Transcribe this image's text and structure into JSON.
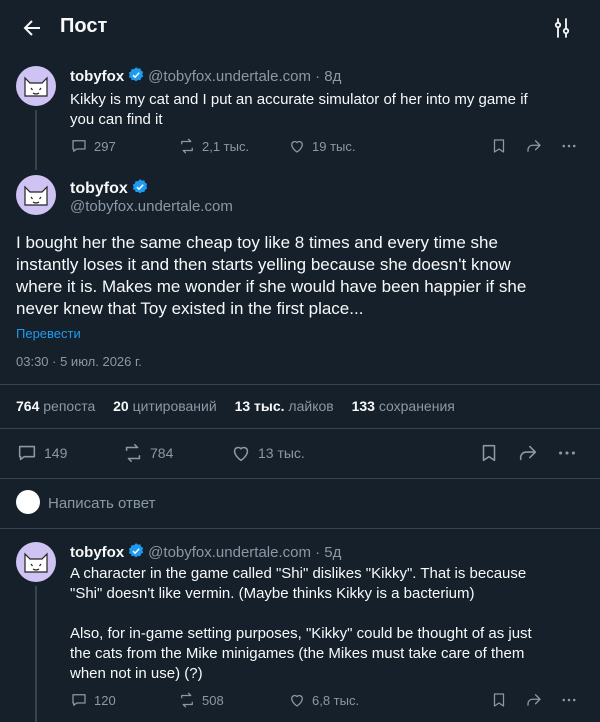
{
  "header": {
    "title": "Пост"
  },
  "parent": {
    "name": "tobyfox",
    "handle_time": "@tobyfox.undertale.com · 8д",
    "line1": "Kikky is my cat and I put an accurate simulator of her into my game if",
    "line2": "you can find it",
    "replies": "297",
    "reposts": "2,1 тыс.",
    "likes": "19 тыс."
  },
  "main": {
    "name": "tobyfox",
    "handle": "@tobyfox.undertale.com",
    "line1": "I bought her the same cheap toy like 8 times and every time she",
    "line2": "instantly loses it and then starts yelling because she doesn't know",
    "line3": "where it is. Makes me wonder if she would have been happier if she",
    "line4": "never knew that Toy existed in the first place...",
    "translate": "Перевести",
    "timestamp": "03:30 · 5 июл. 2026 г.",
    "stats": {
      "reposts_count": "764",
      "reposts_label": "репоста",
      "quotes_count": "20",
      "quotes_label": "цитирований",
      "likes_count": "13 тыс.",
      "likes_label": "лайков",
      "bookmarks_count": "133",
      "bookmarks_label": "сохранения"
    },
    "replies": "149",
    "reposts": "784",
    "likes": "13 тыс."
  },
  "compose": {
    "placeholder": "Написать ответ"
  },
  "reply": {
    "name": "tobyfox",
    "handle_time": "@tobyfox.undertale.com · 5д",
    "line1": "A character in the game called \"Shi\" dislikes \"Kikky\". That is because",
    "line2": "\"Shi\" doesn't like vermin. (Maybe thinks Kikky is a bacterium)",
    "line3": "Also, for in-game setting purposes, \"Kikky\" could be thought of as just",
    "line4": "the cats from the Mike minigames (the Mikes must take care of them",
    "line5": "when not in use) (?)",
    "replies": "120",
    "reposts": "508",
    "likes": "6,8 тыс."
  },
  "colors": {
    "background": "#15202b",
    "accent": "#1d9bf0",
    "muted": "#8b98a5",
    "avatar_bg": "#cfc3f4"
  }
}
